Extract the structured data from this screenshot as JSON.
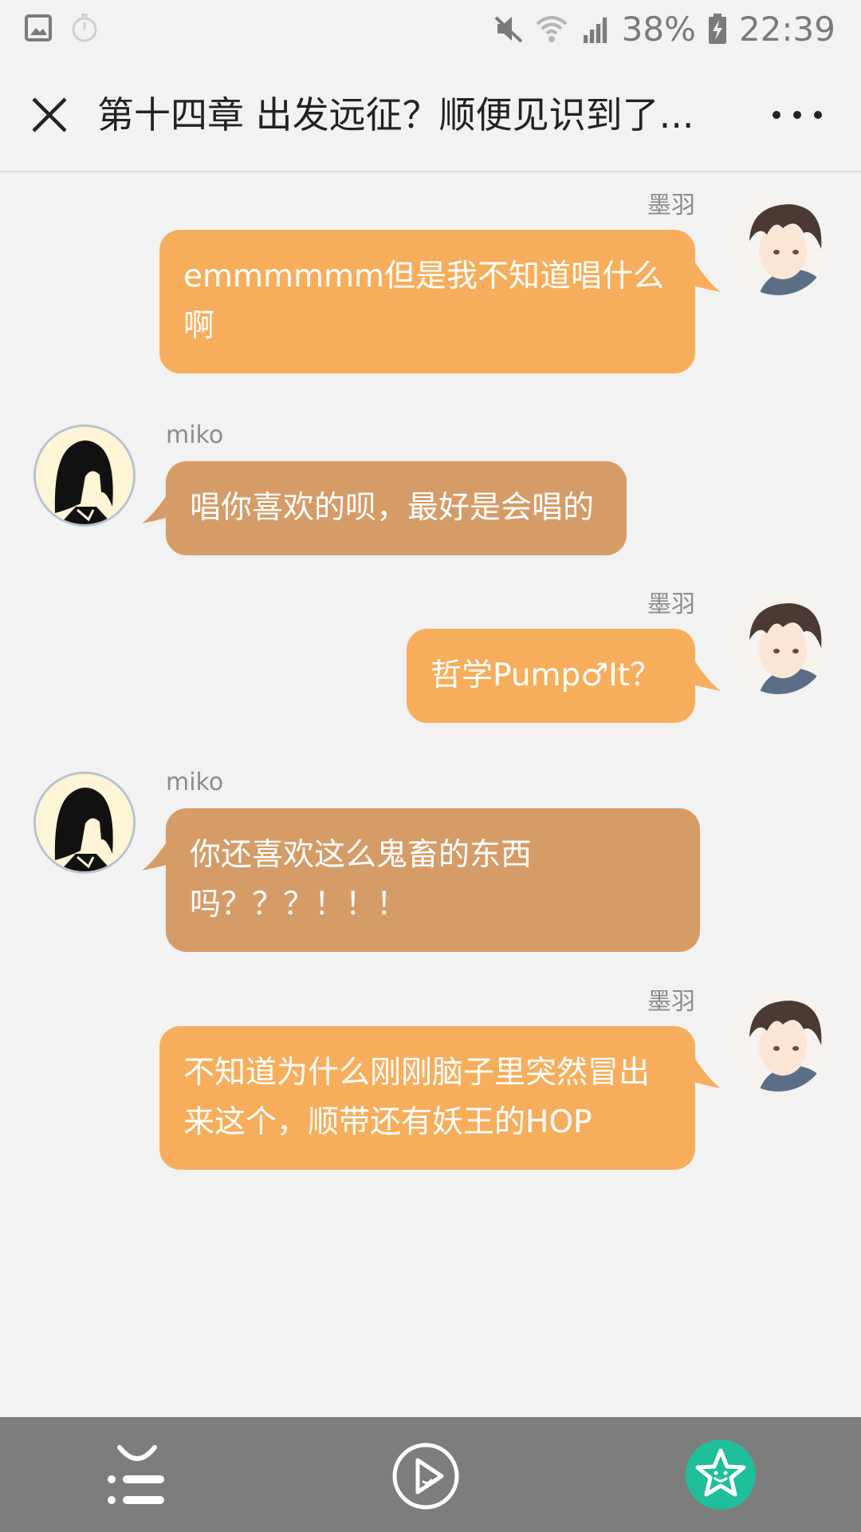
{
  "status_bar": {
    "battery": "38%",
    "time": "22:39",
    "icons": [
      "image-icon",
      "timer-icon",
      "mute-icon",
      "wifi-icon",
      "signal-icon",
      "battery-charging-icon"
    ]
  },
  "header": {
    "title": "第十四章 出发远征？顺便见识到了...",
    "close_icon": "close-icon",
    "more_icon": "more-horizontal-icon"
  },
  "messages": [
    {
      "side": "right",
      "sender": "墨羽",
      "text_lines": [
        "emmmmmm但是我不知道唱什么",
        "啊"
      ]
    },
    {
      "side": "left",
      "sender": "miko",
      "text_lines": [
        "唱你喜欢的呗，最好是会唱的"
      ]
    },
    {
      "side": "right",
      "sender": "墨羽",
      "text_lines": [
        "哲学Pump♂It？"
      ]
    },
    {
      "side": "left",
      "sender": "miko",
      "text_lines": [
        "你还喜欢这么鬼畜的东西",
        "吗？？？！！！"
      ]
    },
    {
      "side": "right",
      "sender": "墨羽",
      "text_lines": [
        "不知道为什么刚刚脑子里突然冒出",
        "来这个，顺带还有妖王的HOP"
      ]
    }
  ],
  "colors": {
    "background": "#f2f2f2",
    "bubble_right": "#f7ae5c",
    "bubble_left": "#d69c68",
    "bottom_bar": "#7d7d7d",
    "star_button": "#1fbf9a"
  },
  "bottom_bar": {
    "icons": [
      "chapter-list-icon",
      "auto-play-icon",
      "favorite-star-icon"
    ]
  }
}
